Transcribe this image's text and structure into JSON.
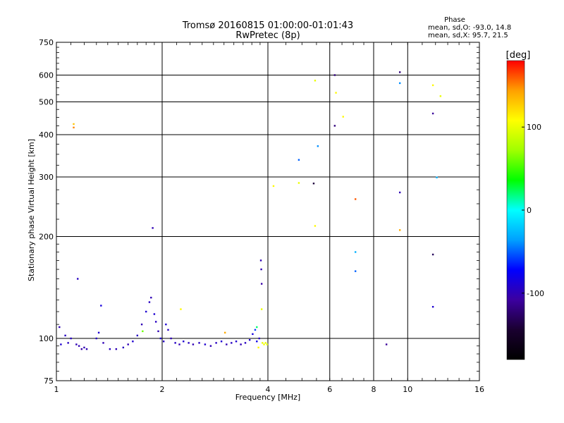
{
  "chart_data": {
    "type": "scatter",
    "title": "Tromsø 20160815 01:00:00-01:01:43",
    "subtitle": "RwPretec (8p)",
    "xlabel": "Frequency [MHz]",
    "ylabel": "Stationary phase Virtual Height [km]",
    "x_scale": "log2",
    "y_scale": "log",
    "xlim": [
      1,
      16
    ],
    "ylim": [
      75,
      750
    ],
    "x_ticks": [
      1,
      2,
      4,
      6,
      8,
      10,
      16
    ],
    "x_tick_labels": [
      "1",
      "2",
      "4",
      "6",
      "8",
      "10",
      "16"
    ],
    "x_grid_lines": [
      2,
      4,
      6,
      8,
      10
    ],
    "y_ticks": [
      75,
      100,
      200,
      300,
      400,
      500,
      600,
      750
    ],
    "y_tick_labels": [
      "75",
      "100",
      "200",
      "300",
      "400",
      "500",
      "600",
      "750"
    ],
    "y_grid_lines": [
      100,
      200,
      300,
      400,
      500,
      600
    ],
    "grid": true,
    "stats": {
      "heading": "Phase",
      "line_o": "mean, sd,O: -93.0, 14.8",
      "line_x": "mean, sd,X:  95.7, 21.5"
    },
    "colorbar": {
      "label": "[deg]",
      "range": [
        -180,
        180
      ],
      "ticks": [
        100,
        0,
        -100
      ],
      "tick_labels": [
        "100",
        "0",
        "-100"
      ],
      "color_stops": [
        "#000000",
        "#1a0030",
        "#3c00a0",
        "#0000ff",
        "#00a0ff",
        "#00ffff",
        "#00ff00",
        "#a0ff00",
        "#ffff00",
        "#ffa000",
        "#ff0000"
      ]
    },
    "points": [
      [
        1.12,
        430,
        130
      ],
      [
        1.12,
        420,
        150
      ],
      [
        1.88,
        212,
        -100
      ],
      [
        1.15,
        150,
        -95
      ],
      [
        1.34,
        125,
        -85
      ],
      [
        1.02,
        108,
        -100
      ],
      [
        1.06,
        102,
        -95
      ],
      [
        1.1,
        100,
        -95
      ],
      [
        1.14,
        96,
        -100
      ],
      [
        1.18,
        93,
        -105
      ],
      [
        1.2,
        94,
        -100
      ],
      [
        1.03,
        96,
        -90
      ],
      [
        1.08,
        97,
        -95
      ],
      [
        1.16,
        95,
        -100
      ],
      [
        1.22,
        93,
        -100
      ],
      [
        1.3,
        100,
        -95
      ],
      [
        1.32,
        104,
        -90
      ],
      [
        1.36,
        97,
        -100
      ],
      [
        1.42,
        93,
        -95
      ],
      [
        1.48,
        93,
        -100
      ],
      [
        1.55,
        94,
        -95
      ],
      [
        1.6,
        96,
        -100
      ],
      [
        1.65,
        98,
        -90
      ],
      [
        1.7,
        102,
        -95
      ],
      [
        1.75,
        110,
        -100
      ],
      [
        1.8,
        120,
        -90
      ],
      [
        1.84,
        128,
        -95
      ],
      [
        1.86,
        132,
        -100
      ],
      [
        1.9,
        118,
        -90
      ],
      [
        1.92,
        112,
        -95
      ],
      [
        1.95,
        105,
        -100
      ],
      [
        1.98,
        100,
        -90
      ],
      [
        2.02,
        98,
        -95
      ],
      [
        2.05,
        110,
        -90
      ],
      [
        2.08,
        106,
        -95
      ],
      [
        2.12,
        100,
        -100
      ],
      [
        2.18,
        97,
        -95
      ],
      [
        2.24,
        96,
        -100
      ],
      [
        2.3,
        98,
        -90
      ],
      [
        2.38,
        97,
        -95
      ],
      [
        2.45,
        96,
        -100
      ],
      [
        2.55,
        97,
        -95
      ],
      [
        2.65,
        96,
        -90
      ],
      [
        2.75,
        95,
        -100
      ],
      [
        2.85,
        97,
        -95
      ],
      [
        2.95,
        98,
        -90
      ],
      [
        3.05,
        96,
        -100
      ],
      [
        3.15,
        97,
        -95
      ],
      [
        3.25,
        98,
        -90
      ],
      [
        3.35,
        96,
        -100
      ],
      [
        3.45,
        97,
        -95
      ],
      [
        3.55,
        99,
        -90
      ],
      [
        3.62,
        103,
        -85
      ],
      [
        3.68,
        106,
        -60
      ],
      [
        3.72,
        98,
        -80
      ],
      [
        3.78,
        100,
        -95
      ],
      [
        3.82,
        170,
        -100
      ],
      [
        3.83,
        160,
        -100
      ],
      [
        3.84,
        145,
        -105
      ],
      [
        3.84,
        122,
        100
      ],
      [
        3.86,
        97,
        100
      ],
      [
        3.9,
        96,
        105
      ],
      [
        3.94,
        97,
        100
      ],
      [
        3.98,
        96,
        95
      ],
      [
        3.76,
        94,
        110
      ],
      [
        2.26,
        122,
        110
      ],
      [
        3.02,
        104,
        140
      ],
      [
        1.76,
        105,
        60
      ],
      [
        3.72,
        108,
        20
      ],
      [
        4.15,
        282,
        110
      ],
      [
        4.9,
        337,
        -50
      ],
      [
        4.9,
        288,
        100
      ],
      [
        5.4,
        287,
        -140
      ],
      [
        5.45,
        578,
        100
      ],
      [
        5.45,
        215,
        110
      ],
      [
        5.55,
        370,
        -40
      ],
      [
        6.2,
        600,
        -120
      ],
      [
        6.2,
        425,
        -120
      ],
      [
        6.25,
        532,
        110
      ],
      [
        6.55,
        452,
        110
      ],
      [
        7.1,
        258,
        160
      ],
      [
        7.1,
        180,
        -30
      ],
      [
        7.1,
        158,
        -50
      ],
      [
        8.7,
        96,
        -110
      ],
      [
        9.5,
        612,
        -120
      ],
      [
        9.5,
        568,
        -40
      ],
      [
        9.5,
        270,
        -100
      ],
      [
        9.5,
        209,
        140
      ],
      [
        11.8,
        560,
        110
      ],
      [
        11.8,
        462,
        -110
      ],
      [
        11.8,
        177,
        -130
      ],
      [
        11.8,
        124,
        -90
      ],
      [
        12.1,
        299,
        -30
      ],
      [
        12.4,
        520,
        100
      ]
    ]
  }
}
